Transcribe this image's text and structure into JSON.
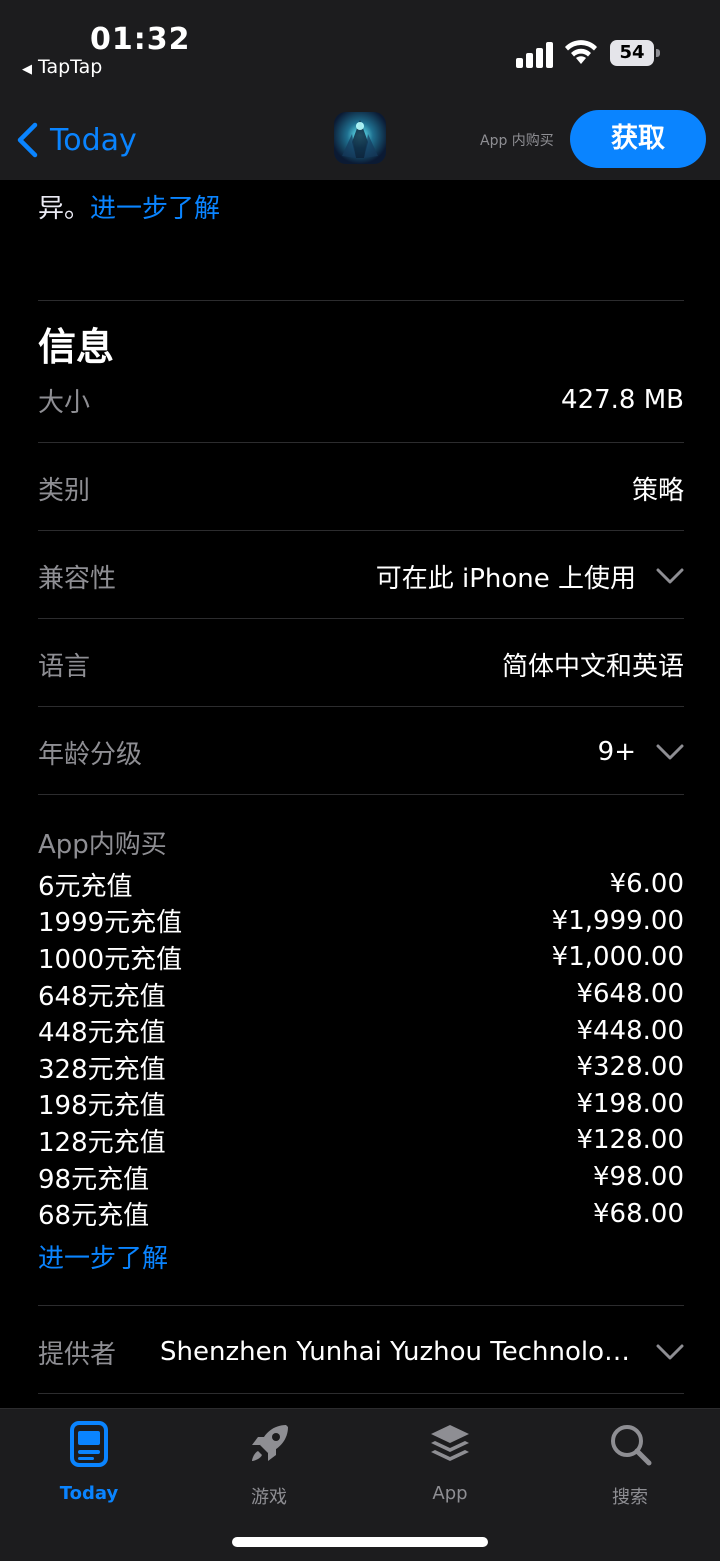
{
  "status_bar": {
    "time": "01:32",
    "back_app": "TapTap",
    "battery": "54"
  },
  "header": {
    "back_label": "Today",
    "iap_hint": "App 内购买",
    "get_button": "获取"
  },
  "description": {
    "tail_text": "异。",
    "more_link": "进一步了解"
  },
  "info": {
    "title": "信息",
    "rows": [
      {
        "label": "大小",
        "value": "427.8 MB"
      },
      {
        "label": "类别",
        "value": "策略"
      },
      {
        "label": "兼容性",
        "value": "可在此 iPhone 上使用"
      },
      {
        "label": "语言",
        "value": "简体中文和英语"
      },
      {
        "label": "年龄分级",
        "value": "9+"
      }
    ],
    "iap_title": "App内购买",
    "iap_items": [
      {
        "name": "6元充值",
        "price": "¥6.00"
      },
      {
        "name": "1999元充值",
        "price": "¥1,999.00"
      },
      {
        "name": "1000元充值",
        "price": "¥1,000.00"
      },
      {
        "name": "648元充值",
        "price": "¥648.00"
      },
      {
        "name": "448元充值",
        "price": "¥448.00"
      },
      {
        "name": "328元充值",
        "price": "¥328.00"
      },
      {
        "name": "198元充值",
        "price": "¥198.00"
      },
      {
        "name": "128元充值",
        "price": "¥128.00"
      },
      {
        "name": "98元充值",
        "price": "¥98.00"
      },
      {
        "name": "68元充值",
        "price": "¥68.00"
      }
    ],
    "iap_more": "进一步了解",
    "provider_label": "提供者",
    "provider_value": "Shenzhen Yunhai Yuzhou Technolog..."
  },
  "tabs": [
    {
      "label": "Today",
      "icon": "today-icon",
      "active": true
    },
    {
      "label": "游戏",
      "icon": "rocket-icon",
      "active": false
    },
    {
      "label": "App",
      "icon": "stack-icon",
      "active": false
    },
    {
      "label": "搜索",
      "icon": "search-icon",
      "active": false
    }
  ],
  "colors": {
    "accent": "#0a84ff",
    "background": "#000000",
    "secondary_text": "#8e8e93"
  }
}
